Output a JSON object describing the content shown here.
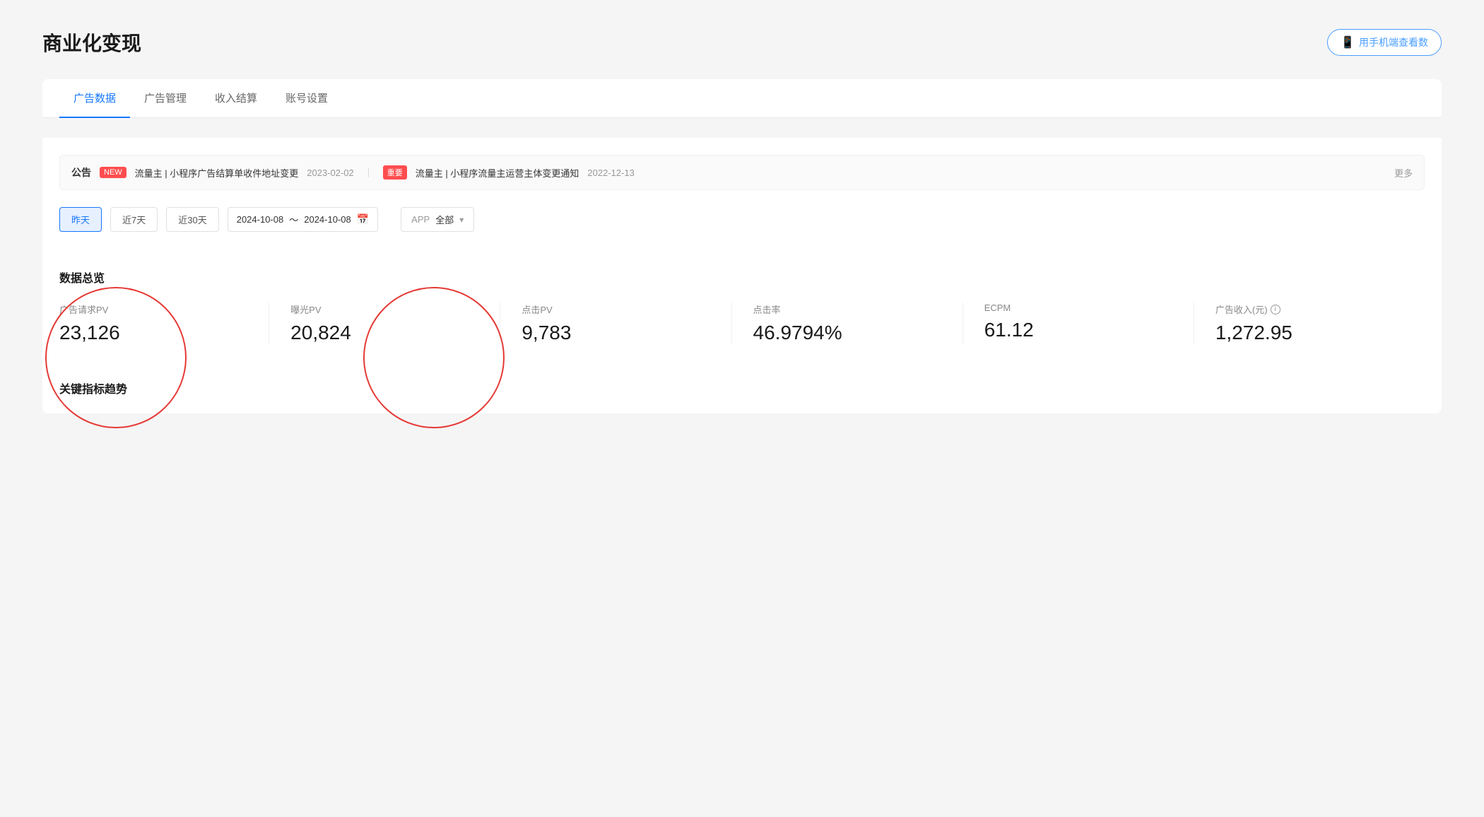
{
  "page": {
    "title": "商业化变现",
    "mobile_check_btn": "用手机端查看数"
  },
  "tabs": [
    {
      "id": "ad-data",
      "label": "广告数据",
      "active": true
    },
    {
      "id": "ad-manage",
      "label": "广告管理",
      "active": false
    },
    {
      "id": "income-settle",
      "label": "收入结算",
      "active": false
    },
    {
      "id": "account-settings",
      "label": "账号设置",
      "active": false
    }
  ],
  "notice": {
    "label": "公告",
    "items": [
      {
        "badge": "NEW",
        "badge_type": "new",
        "text": "流量主 | 小程序广告结算单收件地址变更",
        "date": "2023-02-02"
      },
      {
        "badge": "重要",
        "badge_type": "important",
        "text": "流量主 | 小程序流量主运营主体变更通知",
        "date": "2022-12-13"
      }
    ],
    "more": "更多"
  },
  "filter": {
    "time_buttons": [
      {
        "label": "昨天",
        "active": true
      },
      {
        "label": "近7天",
        "active": false
      },
      {
        "label": "近30天",
        "active": false
      }
    ],
    "date_start": "2024-10-08",
    "date_end": "2024-10-08",
    "date_separator": "～",
    "app_label": "APP",
    "app_value": "全部"
  },
  "data_overview": {
    "title": "数据总览",
    "metrics": [
      {
        "id": "ad-request-pv",
        "label": "广告请求PV",
        "value": "23,126",
        "has_info": false
      },
      {
        "id": "exposure-pv",
        "label": "曝光PV",
        "value": "20,824",
        "has_info": false
      },
      {
        "id": "click-pv",
        "label": "点击PV",
        "value": "9,783",
        "has_info": false
      },
      {
        "id": "click-rate",
        "label": "点击率",
        "value": "46.9794%",
        "has_info": false
      },
      {
        "id": "ecpm",
        "label": "ECPM",
        "value": "61.12",
        "has_info": false
      },
      {
        "id": "ad-revenue",
        "label": "广告收入(元)",
        "value": "1,272.95",
        "has_info": true
      }
    ]
  },
  "trend": {
    "title": "关键指标趋势"
  },
  "icons": {
    "phone": "📱",
    "calendar": "📅",
    "chevron_down": "▾",
    "info": "i"
  }
}
